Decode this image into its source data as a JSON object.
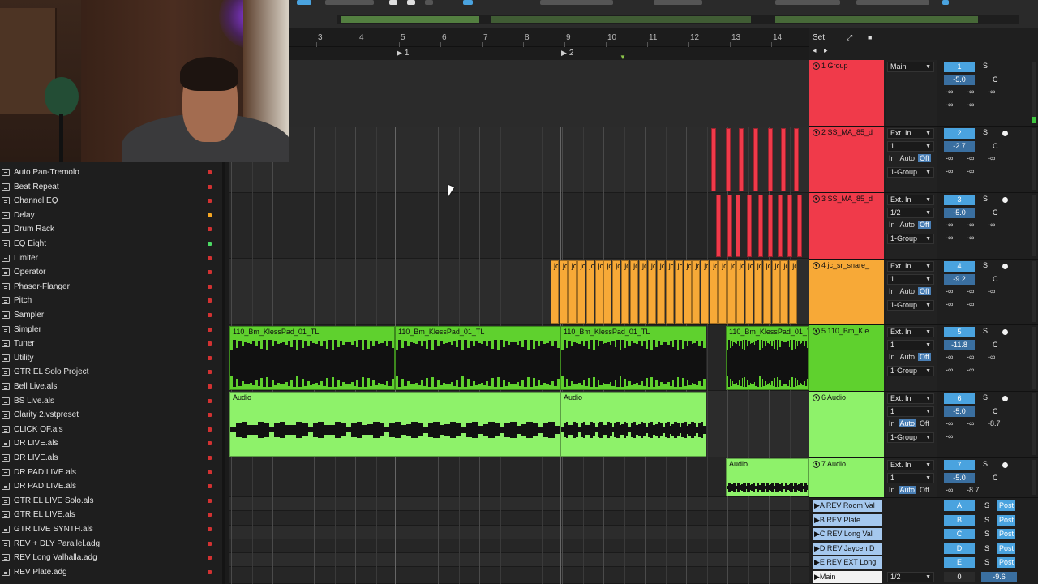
{
  "ruler": {
    "bars": [
      "3",
      "4",
      "5",
      "6",
      "7",
      "8",
      "9",
      "10",
      "11",
      "12",
      "13",
      "14"
    ],
    "locators": [
      "1",
      "2"
    ],
    "set_label": "Set"
  },
  "browser": {
    "items": [
      {
        "label": "Auto Pan-Tremolo",
        "dot": "#d23232"
      },
      {
        "label": "Beat Repeat",
        "dot": "#d23232"
      },
      {
        "label": "Channel EQ",
        "dot": "#d23232"
      },
      {
        "label": "Delay",
        "dot": "#f5a623"
      },
      {
        "label": "Drum Rack",
        "dot": "#d23232"
      },
      {
        "label": "EQ Eight",
        "dot": "#4cd964"
      },
      {
        "label": "Limiter",
        "dot": "#d23232"
      },
      {
        "label": "Operator",
        "dot": "#d23232"
      },
      {
        "label": "Phaser-Flanger",
        "dot": "#d23232"
      },
      {
        "label": "Pitch",
        "dot": "#d23232"
      },
      {
        "label": "Sampler",
        "dot": "#d23232"
      },
      {
        "label": "Simpler",
        "dot": "#d23232"
      },
      {
        "label": "Tuner",
        "dot": "#d23232"
      },
      {
        "label": "Utility",
        "dot": "#d23232"
      },
      {
        "label": "GTR EL Solo Project",
        "dot": "#d23232"
      },
      {
        "label": "Bell Live.als",
        "dot": "#d23232"
      },
      {
        "label": "BS Live.als",
        "dot": "#d23232"
      },
      {
        "label": "Clarity 2.vstpreset",
        "dot": "#d23232"
      },
      {
        "label": "CLICK OF.als",
        "dot": "#d23232"
      },
      {
        "label": "DR LIVE.als",
        "dot": "#d23232"
      },
      {
        "label": "DR LIVE.als",
        "dot": "#d23232"
      },
      {
        "label": "DR PAD LIVE.als",
        "dot": "#d23232"
      },
      {
        "label": "DR PAD LIVE.als",
        "dot": "#d23232"
      },
      {
        "label": "GTR EL LIVE Solo.als",
        "dot": "#d23232"
      },
      {
        "label": "GTR EL LIVE.als",
        "dot": "#d23232"
      },
      {
        "label": "GTR LIVE SYNTH.als",
        "dot": "#d23232"
      },
      {
        "label": "REV + DLY Parallel.adg",
        "dot": "#d23232"
      },
      {
        "label": "REV Long Valhalla.adg",
        "dot": "#d23232"
      },
      {
        "label": "REV Plate.adg",
        "dot": "#d23232"
      }
    ]
  },
  "clips": {
    "pad": "110_Bm_KlessPad_01_TL",
    "audio": "Audio",
    "snare": "jc"
  },
  "tracks": [
    {
      "name": "1 Group",
      "color": "#f03a4a",
      "input": "Main",
      "num": "1",
      "vol": "-5.0",
      "pan": "C",
      "sends": [
        "-∞",
        "-∞",
        "-∞",
        "-∞",
        "-∞"
      ]
    },
    {
      "name": "2 SS_MA_85_d",
      "color": "#f03a4a",
      "input": "Ext. In",
      "channel": "1",
      "monitor": [
        "In",
        "Auto",
        "Off"
      ],
      "output": "1-Group",
      "num": "2",
      "vol": "-2.7",
      "pan": "C",
      "sends": [
        "-∞",
        "-∞",
        "-∞",
        "-∞",
        "-∞"
      ]
    },
    {
      "name": "3 SS_MA_85_d",
      "color": "#f03a4a",
      "input": "Ext. In",
      "channel": "1/2",
      "monitor": [
        "In",
        "Auto",
        "Off"
      ],
      "output": "1-Group",
      "num": "3",
      "vol": "-5.0",
      "pan": "C",
      "sends": [
        "-∞",
        "-∞",
        "-∞",
        "-∞",
        "-∞"
      ]
    },
    {
      "name": "4 jc_sr_snare_",
      "color": "#f7a937",
      "input": "Ext. In",
      "channel": "1",
      "monitor": [
        "In",
        "Auto",
        "Off"
      ],
      "output": "1-Group",
      "num": "4",
      "vol": "-9.2",
      "pan": "C",
      "sends": [
        "-∞",
        "-∞",
        "-∞",
        "-∞",
        "-∞"
      ]
    },
    {
      "name": "5 110_Bm_Kle",
      "color": "#5fd12e",
      "input": "Ext. In",
      "channel": "1",
      "monitor": [
        "In",
        "Auto",
        "Off"
      ],
      "output": "1-Group",
      "num": "5",
      "vol": "-11.8",
      "pan": "C",
      "sends": [
        "-∞",
        "-∞",
        "-∞",
        "-∞",
        "-∞"
      ]
    },
    {
      "name": "6 Audio",
      "color": "#8ef26a",
      "input": "Ext. In",
      "channel": "1",
      "monitor": [
        "In",
        "Auto",
        "Off"
      ],
      "output": "1-Group",
      "num": "6",
      "vol": "-5.0",
      "pan": "C",
      "sends": [
        "-∞",
        "-∞",
        "-8.7",
        "-∞"
      ]
    },
    {
      "name": "7 Audio",
      "color": "#8ef26a",
      "input": "Ext. In",
      "channel": "1",
      "monitor": [
        "In",
        "Auto",
        "Off"
      ],
      "num": "7",
      "vol": "-5.0",
      "pan": "C",
      "sends": [
        "-∞",
        "-8.7"
      ]
    }
  ],
  "returns": [
    {
      "name": "A REV Room Val",
      "letter": "A",
      "post": "Post"
    },
    {
      "name": "B REV Plate",
      "letter": "B",
      "post": "Post"
    },
    {
      "name": "C REV Long Val",
      "letter": "C",
      "post": "Post"
    },
    {
      "name": "D REV Jaycen D",
      "letter": "D",
      "post": "Post"
    },
    {
      "name": "E REV EXT Long",
      "letter": "E",
      "post": "Post"
    }
  ],
  "master": {
    "name": "Main",
    "output": "1/2",
    "num": "0",
    "vol": "-9.6"
  },
  "solo_label": "S"
}
